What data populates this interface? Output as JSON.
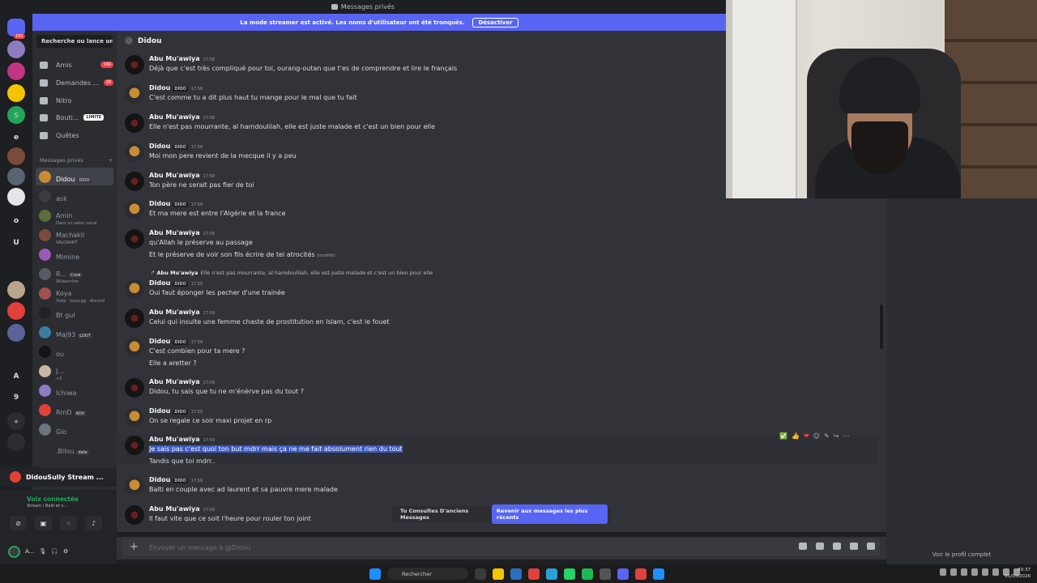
{
  "window": {
    "title": "Messages privés"
  },
  "banner": {
    "text": "La mode streamer est activé. Les noms d'utilisateur ont été tronqués.",
    "button": "Désactiver"
  },
  "rail": {
    "servers": [
      {
        "label": "191",
        "badge": "191",
        "color": "#5865f2"
      },
      {
        "label": "",
        "color": "#8e7cc3"
      },
      {
        "label": "",
        "color": "#c13584"
      },
      {
        "label": "",
        "color": "#f5c400"
      },
      {
        "label": "S",
        "color": "#23a55a"
      },
      {
        "label": "e",
        "color": "#1e1f22"
      },
      {
        "label": "",
        "color": "#7a4b3a"
      },
      {
        "label": "",
        "color": "#596373"
      },
      {
        "label": "",
        "color": "#e5e5e5"
      },
      {
        "label": "o",
        "color": "#1e1f22"
      },
      {
        "label": "U",
        "color": "#1e1f22"
      },
      {
        "label": "",
        "color": "#1e1f22"
      },
      {
        "label": "",
        "color": "#b9a58c"
      },
      {
        "label": "",
        "color": "#e0413a"
      },
      {
        "label": "",
        "color": "#596399"
      },
      {
        "label": "",
        "color": "#1e1f22"
      },
      {
        "label": "A",
        "color": "#1e1f22"
      },
      {
        "label": "9",
        "color": "#1e1f22"
      },
      {
        "label": "+",
        "color": "#2b2d31"
      },
      {
        "label": "",
        "color": "#2b2d31"
      }
    ]
  },
  "sidebar": {
    "search": "Recherche ou lance un...",
    "nav": [
      {
        "label": "Amis",
        "count": "186"
      },
      {
        "label": "Demandes ...",
        "count": "28"
      },
      {
        "label": "Nitro",
        "count": ""
      },
      {
        "label": "Bouti...",
        "limit": "LIMITE"
      },
      {
        "label": "Quêtes",
        "count": ""
      }
    ],
    "section_title": "Messages privés",
    "section_add": "+",
    "dms": [
      {
        "name": "Didou",
        "tag": "DIDO",
        "sub": "",
        "color": "#c98b34",
        "active": true
      },
      {
        "name": "ask",
        "tag": "",
        "sub": "",
        "color": "#3a3c42"
      },
      {
        "name": "Amin",
        "tag": "",
        "sub": "Dans un salon vocal",
        "color": "#5a6e3a"
      },
      {
        "name": "Machakil",
        "tag": "",
        "sub": "VALORANT",
        "color": "#7a4b3a"
      },
      {
        "name": "Mimine",
        "tag": "",
        "sub": "",
        "color": "#9b59b6"
      },
      {
        "name": "R...",
        "tag": "Crow",
        "sub": "SKlauncher",
        "color": "#555a63"
      },
      {
        "name": "Koya",
        "tag": "",
        "sub": "/help · koya.gg · discord",
        "color": "#a05050"
      },
      {
        "name": "Bt gui",
        "tag": "",
        "sub": "",
        "color": "#222222"
      },
      {
        "name": "Maj93",
        "tag": "LOOT",
        "sub": "",
        "color": "#3b7ea1"
      },
      {
        "name": "ou",
        "tag": "",
        "sub": "",
        "color": "#141414"
      },
      {
        "name": "J...",
        "tag": "",
        "sub": "<3",
        "color": "#c9b8a8"
      },
      {
        "name": "Ichiwa",
        "tag": "",
        "sub": "",
        "color": "#8e7cc3"
      },
      {
        "name": "RmD",
        "tag": "ADV",
        "sub": "",
        "color": "#e0413a"
      },
      {
        "name": "Gio",
        "tag": "",
        "sub": "",
        "color": "#6c757d"
      },
      {
        "name": ".Bilou",
        "tag": "date",
        "sub": "",
        "color": "#2d2d2d"
      }
    ],
    "stream": {
      "title": "DidouSully Stream ..."
    },
    "voice": {
      "status": "Voix connectée",
      "channel": "Stream / Balti et s..."
    },
    "user": {
      "name": "A..."
    }
  },
  "chat": {
    "recipient": "Didou",
    "reply_preview": {
      "author": "Abu Mu'awiya",
      "text": "Elle n'est pas mourrante, al hamdoulilah, elle est juste malade et c'est un bien pour elle"
    },
    "messages": [
      {
        "author": "Abu Mu'awiya",
        "tag": "",
        "time": "17:58",
        "lines": [
          "Déjà que c'est très compliqué pour toi, ourang-outan que t'es de comprendre et lire le français"
        ]
      },
      {
        "author": "Didou",
        "tag": "DIDO",
        "time": "17:58",
        "lines": [
          "C'est comme tu a dit plus haut tu mange pour le mal que tu fait"
        ]
      },
      {
        "author": "Abu Mu'awiya",
        "tag": "",
        "time": "17:58",
        "lines": [
          "Elle n'est pas mourrante, al hamdoulilah, elle est juste malade et c'est un bien pour elle"
        ]
      },
      {
        "author": "Didou",
        "tag": "DIDO",
        "time": "17:58",
        "lines": [
          "Moi mon pere revient de la mecque il y a peu"
        ]
      },
      {
        "author": "Abu Mu'awiya",
        "tag": "",
        "time": "17:58",
        "lines": [
          "Ton père ne serait pas fier de toi"
        ]
      },
      {
        "author": "Didou",
        "tag": "DIDO",
        "time": "17:58",
        "lines": [
          "Et ma mere est entre l'Algérie et la france"
        ]
      },
      {
        "author": "Abu Mu'awiya",
        "tag": "",
        "time": "17:58",
        "lines": [
          "qu'Allah le préserve au passage",
          "Et le préserve de voir son fils écrire de tel atrocités"
        ],
        "edited": "(modifié)"
      },
      {
        "author": "Didou",
        "tag": "DIDO",
        "time": "17:59",
        "lines": [
          "Oui faut éponger les pecher d'une trainée"
        ]
      },
      {
        "author": "Abu Mu'awiya",
        "tag": "",
        "time": "17:59",
        "lines": [
          "Celui qui insulte une femme chaste de prostitution en Islam, c'est le fouet"
        ]
      },
      {
        "author": "Didou",
        "tag": "DIDO",
        "time": "17:59",
        "lines": [
          "C'est combien pour ta mere ?",
          "Elle a aretter ?"
        ]
      },
      {
        "author": "Abu Mu'awiya",
        "tag": "",
        "time": "17:59",
        "lines": [
          "Didou, tu sais que tu ne m'énèrve pas du tout ?"
        ]
      },
      {
        "author": "Didou",
        "tag": "DIDO",
        "time": "17:59",
        "lines": [
          "On se regale ce soir maxi projet en rp"
        ]
      },
      {
        "author": "Abu Mu'awiya",
        "tag": "",
        "time": "17:59",
        "lines": [
          "Je sais pas c'est quoi ton but mdrr mais ça ne me fait absolument rien du tout",
          "Tandis que toi mdrr.."
        ]
      },
      {
        "author": "Didou",
        "tag": "DIDO",
        "time": "17:59",
        "lines": [
          "Balti en couple avec ad laurent et sa pauvre mere malade"
        ]
      },
      {
        "author": "Abu Mu'awiya",
        "tag": "",
        "time": "17:59",
        "lines": [
          "Il faut vite que ce soit l'heure pour rouler ton joint"
        ]
      }
    ],
    "reactions": [
      "✅",
      "👍",
      "❤",
      "☺",
      "✎",
      "↪",
      "⋯"
    ],
    "jump_bar": {
      "text": "Tu Consultes D'anciens Messages",
      "button": "Revenir aux messages les plus récents"
    },
    "composer": {
      "placeholder": "Envoyer un message à @Didou"
    }
  },
  "profile": {
    "link": "Voir le profil complet"
  },
  "taskbar": {
    "search": "Rechercher",
    "time": "20:37",
    "date": "01/03/2026"
  }
}
